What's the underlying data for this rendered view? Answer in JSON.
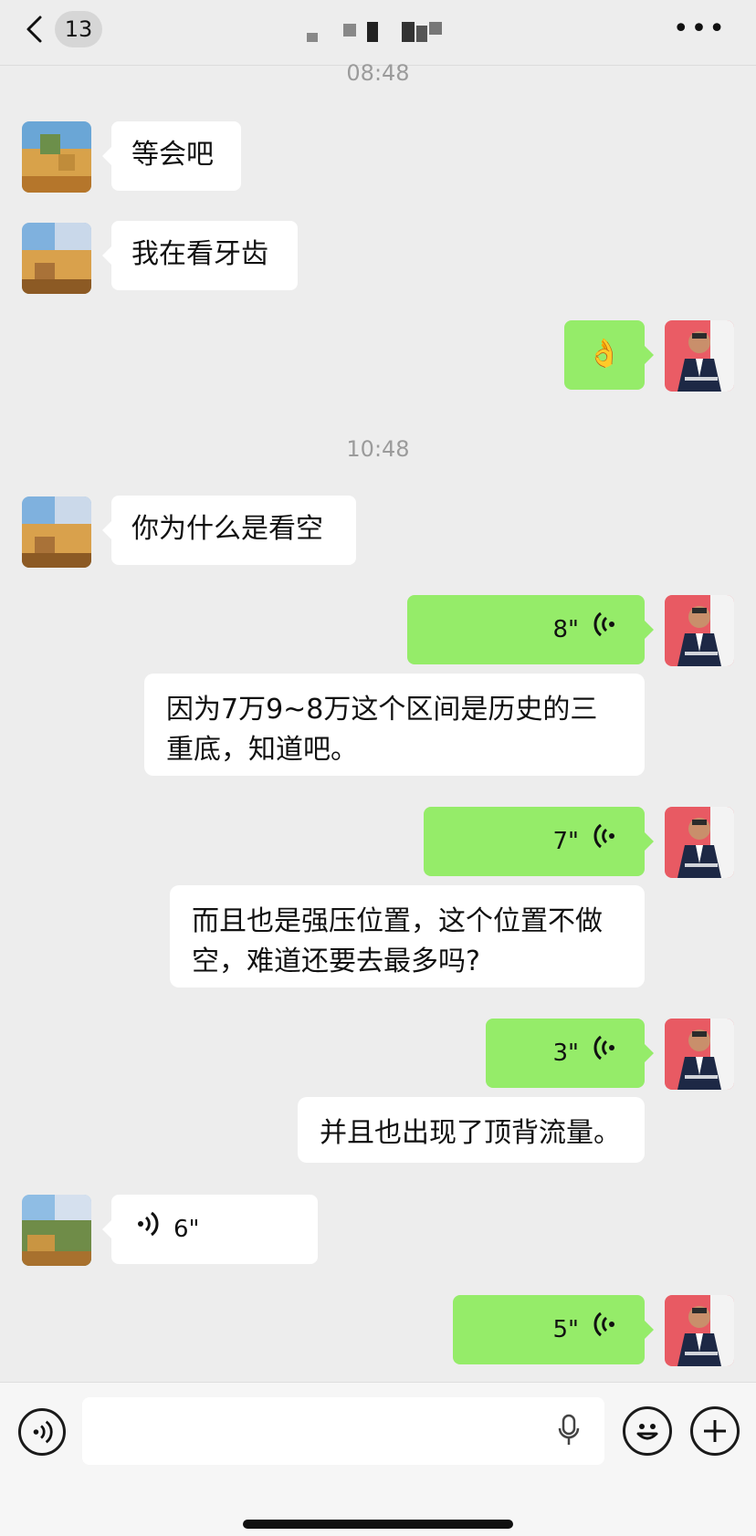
{
  "header": {
    "unread_count": "13",
    "more_glyph": "•••"
  },
  "timestamps": [
    "08:48",
    "10:48"
  ],
  "messages": {
    "m1": "等会吧",
    "m2": "我在看牙齿",
    "m3": "👌",
    "m4": "你为什么是看空",
    "v1": "8\"",
    "t1": "因为7万9~8万这个区间是历史的三重底，知道吧。",
    "v2": "7\"",
    "t2": "而且也是强压位置，这个位置不做空，难道还要去最多吗?",
    "v3": "3\"",
    "t3": "并且也出现了顶背流量。",
    "v4": "6\"",
    "v5": "5\""
  },
  "colors": {
    "background": "#ededed",
    "sent_bubble": "#95ec69",
    "received_bubble": "#ffffff",
    "timestamp": "#9b9b9b"
  },
  "icons": [
    "back-chevron-icon",
    "more-icon",
    "voice-wave-icon",
    "voice-mode-icon",
    "microphone-icon",
    "emoji-icon",
    "plus-icon"
  ]
}
